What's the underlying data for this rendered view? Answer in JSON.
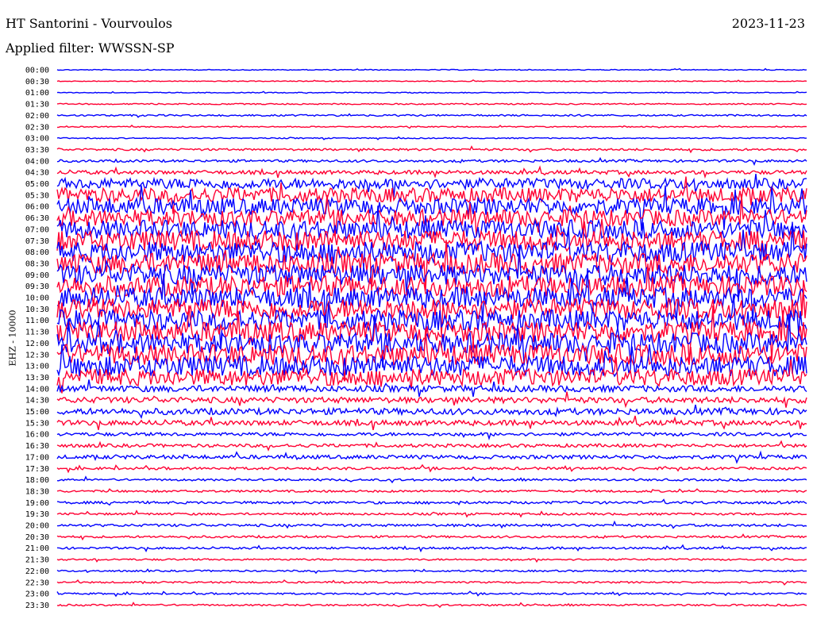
{
  "header": {
    "title": "HT Santorini - Vourvoulos",
    "date": "2023-11-23",
    "filter_label": "Applied filter: WWSSN-SP"
  },
  "chart_data": {
    "type": "line",
    "title": "HT Santorini - Vourvoulos",
    "ylabel": "EHZ - 10000",
    "trace_colors": [
      "#0000ff",
      "#ff0033"
    ],
    "times": [
      "00:00",
      "00:30",
      "01:00",
      "01:30",
      "02:00",
      "02:30",
      "03:00",
      "03:30",
      "04:00",
      "04:30",
      "05:00",
      "05:30",
      "06:00",
      "06:30",
      "07:00",
      "07:30",
      "08:00",
      "08:30",
      "09:00",
      "09:30",
      "10:00",
      "10:30",
      "11:00",
      "11:30",
      "12:00",
      "12:30",
      "13:00",
      "13:30",
      "14:00",
      "14:30",
      "15:00",
      "15:30",
      "16:00",
      "16:30",
      "17:00",
      "17:30",
      "18:00",
      "18:30",
      "19:00",
      "19:30",
      "20:00",
      "20:30",
      "21:00",
      "21:30",
      "22:00",
      "22:30",
      "23:00",
      "23:30"
    ],
    "amplitude_level": [
      0.2,
      0.2,
      0.2,
      0.3,
      0.4,
      0.25,
      0.25,
      0.5,
      0.6,
      0.9,
      2.5,
      3.5,
      4,
      4,
      4.5,
      5,
      5,
      5,
      5,
      5,
      5,
      5,
      5,
      5,
      5,
      5,
      5,
      4,
      1.5,
      1.4,
      1.5,
      1.2,
      0.8,
      0.8,
      0.9,
      0.6,
      0.5,
      0.5,
      0.6,
      0.5,
      0.6,
      0.5,
      0.5,
      0.4,
      0.4,
      0.4,
      0.4,
      0.4
    ]
  }
}
